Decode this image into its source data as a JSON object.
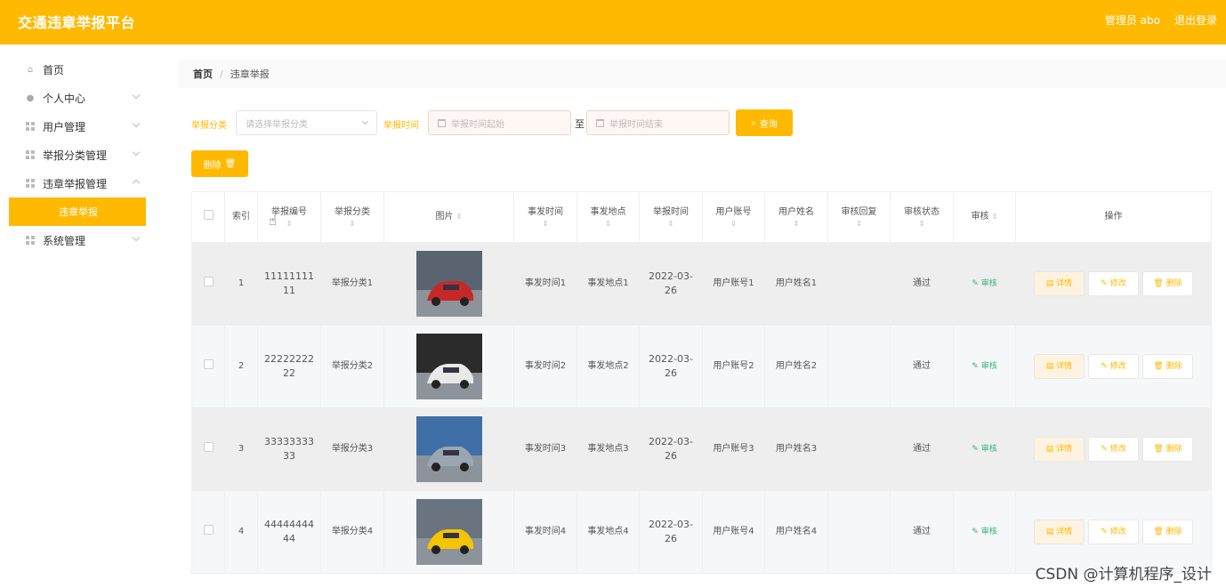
{
  "app": {
    "title": "交通违章举报平台",
    "user": "管理员 abo",
    "logout": "退出登录",
    "accent": "#ffb900"
  },
  "sidebar": {
    "items": [
      {
        "label": "首页",
        "icon": "home-icon"
      },
      {
        "label": "个人中心",
        "icon": "user-icon"
      },
      {
        "label": "用户管理",
        "icon": "grid-icon"
      },
      {
        "label": "举报分类管理",
        "icon": "grid-icon"
      },
      {
        "label": "违章举报管理",
        "icon": "grid-icon"
      },
      {
        "label": "系统管理",
        "icon": "grid-icon"
      }
    ],
    "active_sub": "违章举报"
  },
  "breadcrumb": {
    "home": "首页",
    "sep": "/",
    "current": "违章举报"
  },
  "filters": {
    "category_label": "举报分类",
    "category_placeholder": "请选择举报分类",
    "time_label": "举报时间",
    "start_placeholder": "举报时间起始",
    "to": "至",
    "end_placeholder": "举报时间结束",
    "search_button": "查询",
    "delete_button": "删除"
  },
  "table": {
    "headers": {
      "index": "索引",
      "code": "举报编号",
      "category": "举报分类",
      "image": "图片",
      "event_time": "事发时间",
      "event_place": "事发地点",
      "report_time": "举报时间",
      "account": "用户账号",
      "name": "用户姓名",
      "reply": "审核回复",
      "status": "审核状态",
      "audit": "审核",
      "ops": "操作"
    },
    "rows": [
      {
        "index": "1",
        "code": "1111111111",
        "category": "举报分类1",
        "event_time": "事发时间1",
        "event_place": "事发地点1",
        "report_time": "2022-03-26",
        "account": "用户账号1",
        "name": "用户姓名1",
        "reply": "",
        "status": "通过",
        "audit": "审核",
        "detail": "详情",
        "edit": "修改",
        "del": "删除"
      },
      {
        "index": "2",
        "code": "2222222222",
        "category": "举报分类2",
        "event_time": "事发时间2",
        "event_place": "事发地点2",
        "report_time": "2022-03-26",
        "account": "用户账号2",
        "name": "用户姓名2",
        "reply": "",
        "status": "通过",
        "audit": "审核",
        "detail": "详情",
        "edit": "修改",
        "del": "删除"
      },
      {
        "index": "3",
        "code": "3333333333",
        "category": "举报分类3",
        "event_time": "事发时间3",
        "event_place": "事发地点3",
        "report_time": "2022-03-26",
        "account": "用户账号3",
        "name": "用户姓名3",
        "reply": "",
        "status": "通过",
        "audit": "审核",
        "detail": "详情",
        "edit": "修改",
        "del": "删除"
      },
      {
        "index": "4",
        "code": "4444444444",
        "category": "举报分类4",
        "event_time": "事发时间4",
        "event_place": "事发地点4",
        "report_time": "2022-03-26",
        "account": "用户账号4",
        "name": "用户姓名4",
        "reply": "",
        "status": "通过",
        "audit": "审核",
        "detail": "详情",
        "edit": "修改",
        "del": "删除"
      }
    ]
  },
  "watermark": "CSDN @计算机程序_设计"
}
